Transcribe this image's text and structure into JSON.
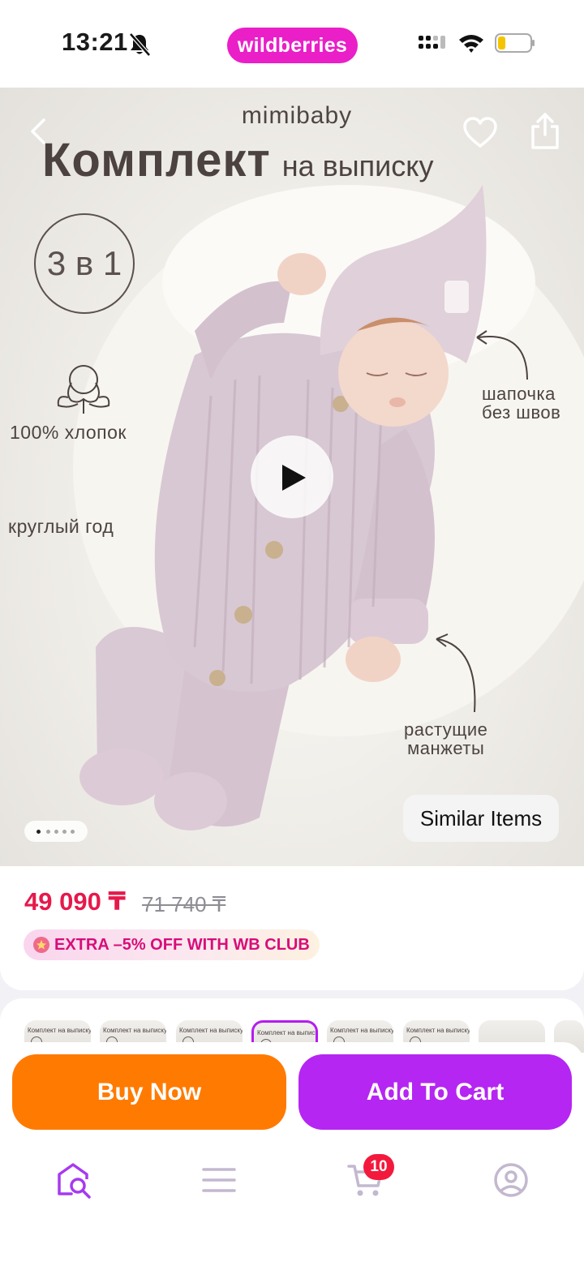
{
  "status_bar": {
    "time": "13:21",
    "brand": "wildberries",
    "brand_color": "#ea1fc8"
  },
  "hero": {
    "image_text": {
      "brand": "mimibaby",
      "title_big": "Комплект",
      "title_small": "на выписку",
      "badge": "3 в 1",
      "cotton": "100% хлопок",
      "year_round": "круглый год",
      "hat_line1": "шапочка",
      "hat_line2": "без швов",
      "cuffs_line1": "растущие",
      "cuffs_line2": "манжеты"
    },
    "slide_count": 5,
    "active_slide": 1,
    "similar_items_label": "Similar Items"
  },
  "price": {
    "current": "49 090 ₸",
    "old": "71 740 ₸",
    "club_offer": "EXTRA –5% OFF WITH WB CLUB",
    "price_color": "#e6194b"
  },
  "thumbnails": {
    "count": 8,
    "active_index": 4,
    "caption": "Комплект на выписку"
  },
  "actions": {
    "buy_now": "Buy Now",
    "add_to_cart": "Add To Cart",
    "buy_color": "#ff7a00",
    "cart_color": "#b526f2"
  },
  "bottom_nav": {
    "items": [
      "home-search-icon",
      "menu-icon",
      "cart-icon",
      "profile-icon"
    ],
    "cart_badge": "10",
    "active_color": "#a73af0"
  }
}
